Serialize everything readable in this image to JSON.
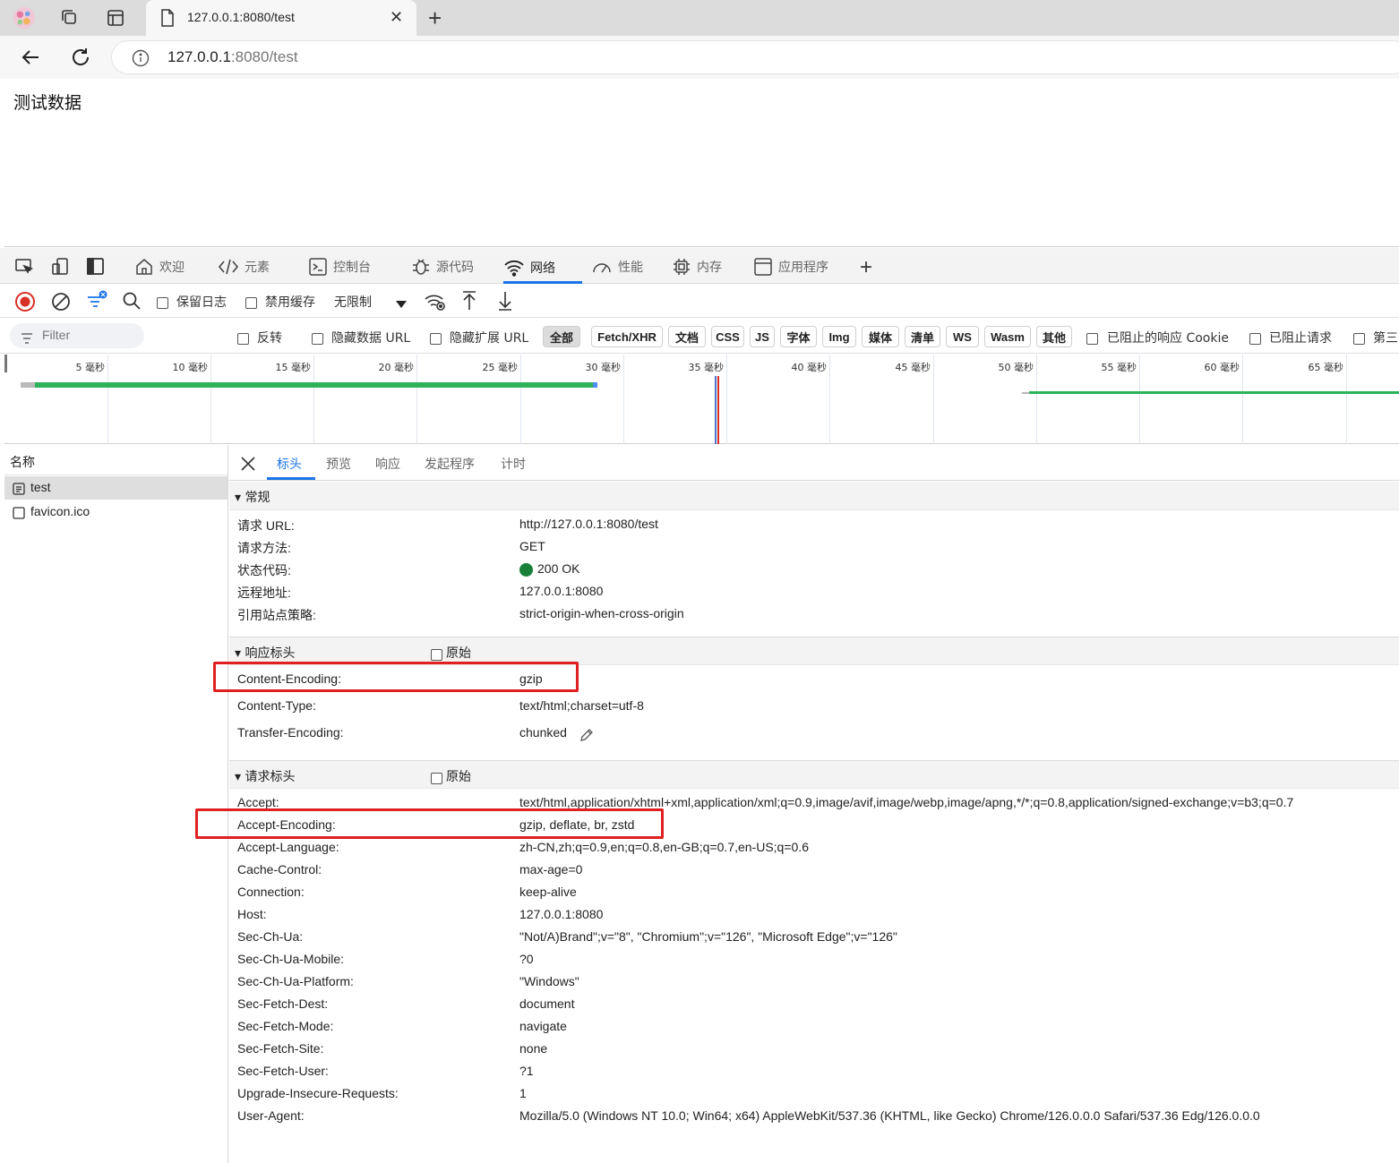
{
  "browser": {
    "tab_title": "127.0.0.1:8080/test",
    "url_host": "127.0.0.1",
    "url_path": ":8080/test",
    "new_tab": "+",
    "close": "✕"
  },
  "page": {
    "text": "测试数据"
  },
  "devtools": {
    "tabs": [
      "欢迎",
      "元素",
      "控制台",
      "源代码",
      "网络",
      "性能",
      "内存",
      "应用程序"
    ],
    "net_toolbar": {
      "preserve_log": "保留日志",
      "disable_cache": "禁用缓存",
      "throttle": "无限制"
    },
    "filter": {
      "placeholder": "Filter",
      "invert": "反转",
      "hide_data_url": "隐藏数据 URL",
      "hide_ext_url": "隐藏扩展 URL",
      "types": [
        "全部",
        "Fetch/XHR",
        "文档",
        "CSS",
        "JS",
        "字体",
        "Img",
        "媒体",
        "清单",
        "WS",
        "Wasm",
        "其他"
      ],
      "blocked_cookies": "已阻止的响应 Cookie",
      "blocked_requests": "已阻止请求",
      "third_party": "第三"
    },
    "timeline": {
      "ticks": [
        "5 毫秒",
        "10 毫秒",
        "15 毫秒",
        "20 毫秒",
        "25 毫秒",
        "30 毫秒",
        "35 毫秒",
        "40 毫秒",
        "45 毫秒",
        "50 毫秒",
        "55 毫秒",
        "60 毫秒",
        "65 毫秒"
      ]
    },
    "name_column": {
      "header": "名称",
      "rows": [
        "test",
        "favicon.ico"
      ]
    },
    "detail_tabs": [
      "标头",
      "预览",
      "响应",
      "发起程序",
      "计时"
    ],
    "general": {
      "title": "常规",
      "rows": [
        {
          "k": "请求 URL:",
          "v": "http://127.0.0.1:8080/test"
        },
        {
          "k": "请求方法:",
          "v": "GET"
        },
        {
          "k": "状态代码:",
          "v": "200 OK"
        },
        {
          "k": "远程地址:",
          "v": "127.0.0.1:8080"
        },
        {
          "k": "引用站点策略:",
          "v": "strict-origin-when-cross-origin"
        }
      ]
    },
    "response_headers": {
      "title": "响应标头",
      "raw": "原始",
      "rows": [
        {
          "k": "Content-Encoding:",
          "v": "gzip"
        },
        {
          "k": "Content-Type:",
          "v": "text/html;charset=utf-8"
        },
        {
          "k": "Transfer-Encoding:",
          "v": "chunked"
        }
      ]
    },
    "request_headers": {
      "title": "请求标头",
      "raw": "原始",
      "rows": [
        {
          "k": "Accept:",
          "v": "text/html,application/xhtml+xml,application/xml;q=0.9,image/avif,image/webp,image/apng,*/*;q=0.8,application/signed-exchange;v=b3;q=0.7"
        },
        {
          "k": "Accept-Encoding:",
          "v": "gzip, deflate, br, zstd"
        },
        {
          "k": "Accept-Language:",
          "v": "zh-CN,zh;q=0.9,en;q=0.8,en-GB;q=0.7,en-US;q=0.6"
        },
        {
          "k": "Cache-Control:",
          "v": "max-age=0"
        },
        {
          "k": "Connection:",
          "v": "keep-alive"
        },
        {
          "k": "Host:",
          "v": "127.0.0.1:8080"
        },
        {
          "k": "Sec-Ch-Ua:",
          "v": "\"Not/A)Brand\";v=\"8\", \"Chromium\";v=\"126\", \"Microsoft Edge\";v=\"126\""
        },
        {
          "k": "Sec-Ch-Ua-Mobile:",
          "v": "?0"
        },
        {
          "k": "Sec-Ch-Ua-Platform:",
          "v": "\"Windows\""
        },
        {
          "k": "Sec-Fetch-Dest:",
          "v": "document"
        },
        {
          "k": "Sec-Fetch-Mode:",
          "v": "navigate"
        },
        {
          "k": "Sec-Fetch-Site:",
          "v": "none"
        },
        {
          "k": "Sec-Fetch-User:",
          "v": "?1"
        },
        {
          "k": "Upgrade-Insecure-Requests:",
          "v": "1"
        },
        {
          "k": "User-Agent:",
          "v": "Mozilla/5.0 (Windows NT 10.0; Win64; x64) AppleWebKit/537.36 (KHTML, like Gecko) Chrome/126.0.0.0 Safari/537.36 Edg/126.0.0.0"
        }
      ]
    },
    "colors": {
      "accent": "#1a73e8",
      "status_ok": "#188038",
      "highlight": "#e02020",
      "timing_bar": "#2fb35a"
    }
  }
}
